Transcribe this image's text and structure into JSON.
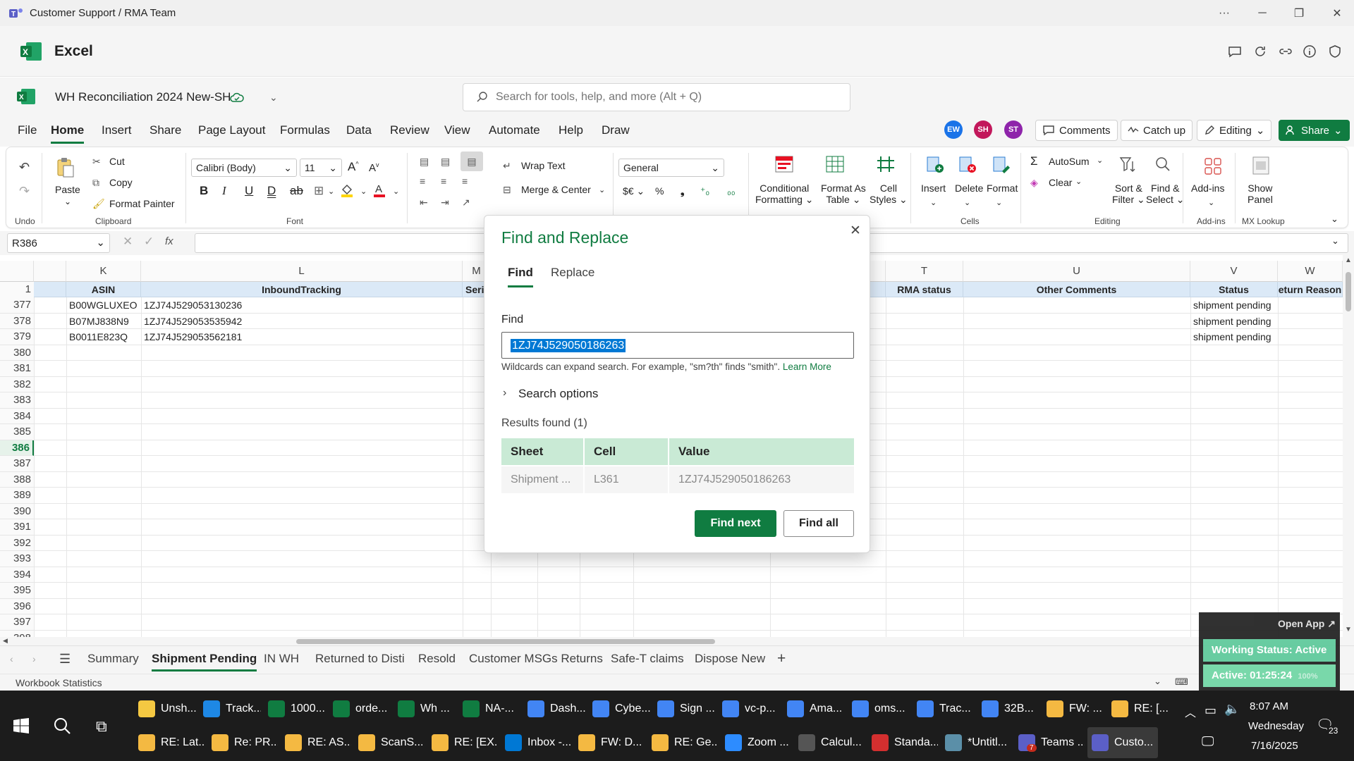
{
  "window": {
    "title": "Customer Support / RMA Team"
  },
  "app": {
    "name": "Excel"
  },
  "document": {
    "name": "WH Reconciliation 2024 New-SH"
  },
  "search": {
    "placeholder": "Search for tools, help, and more (Alt + Q)"
  },
  "menu": {
    "tabs": [
      "File",
      "Home",
      "Insert",
      "Share",
      "Page Layout",
      "Formulas",
      "Data",
      "Review",
      "View",
      "Automate",
      "Help",
      "Draw"
    ],
    "active": "Home"
  },
  "collaborators": [
    {
      "initials": "EW",
      "color": "#1a73e8"
    },
    {
      "initials": "SH",
      "color": "#c2185b"
    },
    {
      "initials": "ST",
      "color": "#8e24aa"
    }
  ],
  "header_buttons": {
    "comments": "Comments",
    "catchup": "Catch up",
    "editing": "Editing",
    "share": "Share"
  },
  "ribbon": {
    "undo_group": "Undo",
    "clipboard": {
      "paste": "Paste",
      "cut": "Cut",
      "copy": "Copy",
      "format_painter": "Format Painter",
      "group": "Clipboard"
    },
    "font": {
      "family": "Calibri (Body)",
      "size": "11",
      "group": "Font"
    },
    "alignment": {
      "wrap": "Wrap Text",
      "merge": "Merge & Center"
    },
    "number": {
      "format": "General"
    },
    "styles": {
      "conditional": "Conditional",
      "conditional2": "Formatting",
      "format_table": "Format As",
      "format_table2": "Table",
      "cell_styles": "Cell",
      "cell_styles2": "Styles"
    },
    "cells": {
      "insert": "Insert",
      "delete": "Delete",
      "format": "Format",
      "group": "Cells"
    },
    "editing": {
      "autosum": "AutoSum",
      "clear": "Clear",
      "sort": "Sort &",
      "sort2": "Filter",
      "find": "Find &",
      "find2": "Select",
      "group": "Editing"
    },
    "addins": {
      "label": "Add-ins",
      "group": "Add-ins"
    },
    "mx": {
      "label": "Show",
      "label2": "Panel",
      "group": "MX Lookup"
    }
  },
  "formula_bar": {
    "name_box": "R386",
    "fx": "fx"
  },
  "grid": {
    "columns": [
      {
        "letter": "K",
        "header": "ASIN"
      },
      {
        "letter": "L",
        "header": "InboundTracking"
      },
      {
        "letter": "M",
        "header": "Seri"
      },
      {
        "letter": "T",
        "header": "RMA status"
      },
      {
        "letter": "U",
        "header": "Other Comments"
      },
      {
        "letter": "V",
        "header": "Status"
      },
      {
        "letter": "W",
        "header": "eturn Reason"
      }
    ],
    "header_row_number": "1",
    "rows": [
      {
        "num": "377",
        "asin": "B00WGLUXEO",
        "tracking": "1ZJ74J529053130236",
        "status": "shipment pending"
      },
      {
        "num": "378",
        "asin": "B07MJ838N9",
        "tracking": "1ZJ74J529053535942",
        "status": "shipment pending"
      },
      {
        "num": "379",
        "asin": "B0011E823Q",
        "tracking": "1ZJ74J529053562181",
        "status": "shipment pending"
      },
      {
        "num": "380"
      },
      {
        "num": "381"
      },
      {
        "num": "382"
      },
      {
        "num": "383"
      },
      {
        "num": "384"
      },
      {
        "num": "385"
      },
      {
        "num": "386",
        "selected": true
      },
      {
        "num": "387"
      },
      {
        "num": "388"
      },
      {
        "num": "389"
      },
      {
        "num": "390"
      },
      {
        "num": "391"
      },
      {
        "num": "392"
      },
      {
        "num": "393"
      },
      {
        "num": "394"
      },
      {
        "num": "395"
      },
      {
        "num": "396"
      },
      {
        "num": "397"
      },
      {
        "num": "398"
      }
    ]
  },
  "sheets": {
    "tabs": [
      "Summary",
      "Shipment Pending",
      "IN WH",
      "Returned to Disti",
      "Resold",
      "Customer MSGs Returns",
      "Safe-T claims",
      "Dispose New"
    ],
    "active": "Shipment Pending"
  },
  "status_bar": {
    "text": "Workbook Statistics"
  },
  "dialog": {
    "title": "Find and Replace",
    "tabs": [
      "Find",
      "Replace"
    ],
    "find_label": "Find",
    "find_value": "1ZJ74J529050186263",
    "hint": "Wildcards can expand search. For example, \"sm?th\" finds \"smith\".",
    "learn_more": "Learn More",
    "search_options": "Search options",
    "results_label": "Results found (1)",
    "results_headers": [
      "Sheet",
      "Cell",
      "Value"
    ],
    "results": [
      {
        "sheet": "Shipment ...",
        "cell": "L361",
        "value": "1ZJ74J529050186263"
      }
    ],
    "find_next": "Find next",
    "find_all": "Find all"
  },
  "overlay": {
    "open_app": "Open App ↗",
    "working_status": "Working Status: Active",
    "active_time": "Active: 01:25:24",
    "zoom": "100%"
  },
  "taskbar": {
    "row1": [
      {
        "label": "Unsh...",
        "color": "#f4c842",
        "icon": "folder-icon"
      },
      {
        "label": "Track...",
        "color": "#1e88e5",
        "icon": "edge-icon"
      },
      {
        "label": "1000...",
        "color": "#107c41",
        "icon": "excel-icon"
      },
      {
        "label": "orde...",
        "color": "#107c41",
        "icon": "excel-icon"
      },
      {
        "label": "Wh ...",
        "color": "#107c41",
        "icon": "excel-icon"
      },
      {
        "label": "NA-...",
        "color": "#107c41",
        "icon": "excel-icon"
      },
      {
        "label": "Dash...",
        "color": "#4285f4",
        "icon": "chrome-icon"
      },
      {
        "label": "Cybe...",
        "color": "#4285f4",
        "icon": "chrome-icon"
      },
      {
        "label": "Sign ...",
        "color": "#4285f4",
        "icon": "chrome-icon"
      },
      {
        "label": "vc-p...",
        "color": "#4285f4",
        "icon": "chrome-icon"
      },
      {
        "label": "Ama...",
        "color": "#4285f4",
        "icon": "chrome-icon"
      },
      {
        "label": "oms...",
        "color": "#4285f4",
        "icon": "chrome-icon"
      },
      {
        "label": "Trac...",
        "color": "#4285f4",
        "icon": "chrome-icon"
      },
      {
        "label": "32B...",
        "color": "#4285f4",
        "icon": "chrome-icon"
      },
      {
        "label": "FW: ...",
        "color": "#f4b942",
        "icon": "mail-icon"
      },
      {
        "label": "RE: [...",
        "color": "#f4b942",
        "icon": "mail-icon"
      }
    ],
    "row2": [
      {
        "label": "RE: Lat...",
        "color": "#f4b942",
        "icon": "mail-icon"
      },
      {
        "label": "Re: PR...",
        "color": "#f4b942",
        "icon": "mail-icon"
      },
      {
        "label": "RE: AS...",
        "color": "#f4b942",
        "icon": "mail-icon"
      },
      {
        "label": "ScanS...",
        "color": "#f4b942",
        "icon": "mail-icon"
      },
      {
        "label": "RE: [EX...",
        "color": "#f4b942",
        "icon": "mail-icon"
      },
      {
        "label": "Inbox -...",
        "color": "#0078d4",
        "icon": "outlook-icon"
      },
      {
        "label": "FW: D...",
        "color": "#f4b942",
        "icon": "mail-icon"
      },
      {
        "label": "RE: Ge...",
        "color": "#f4b942",
        "icon": "mail-icon"
      },
      {
        "label": "Zoom ...",
        "color": "#2d8cff",
        "icon": "zoom-icon"
      },
      {
        "label": "Calcul...",
        "color": "#555555",
        "icon": "calculator-icon"
      },
      {
        "label": "Standa...",
        "color": "#d32f2f",
        "icon": "pdf-icon"
      },
      {
        "label": "*Untitl...",
        "color": "#5b8fa8",
        "icon": "notepad-icon"
      },
      {
        "label": "Teams ...",
        "color": "#5b5fc7",
        "icon": "teams-icon"
      },
      {
        "label": "Custo...",
        "color": "#5b5fc7",
        "icon": "teams-icon"
      }
    ],
    "teams_badge": "7",
    "clock": {
      "time": "8:07 AM",
      "day": "Wednesday",
      "date": "7/16/2025"
    },
    "notif_count": "23"
  }
}
